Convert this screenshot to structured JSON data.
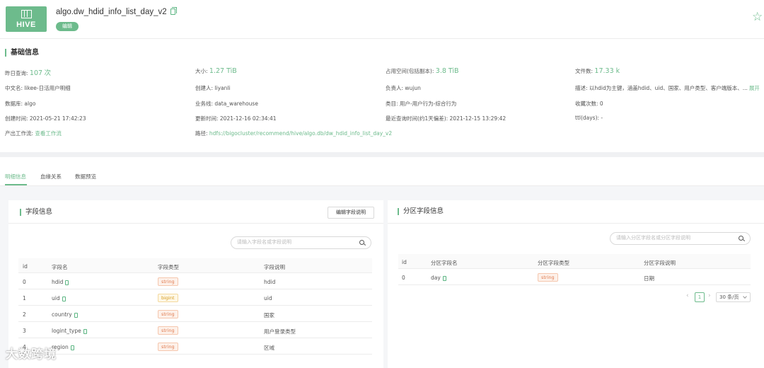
{
  "header": {
    "logo_text": "HIVE",
    "table_name": "algo.dw_hdid_info_list_day_v2",
    "edit_tag": "编辑"
  },
  "basic": {
    "title": "基础信息",
    "yesterday_query_label": "昨日查询:",
    "yesterday_query_value": "107",
    "yesterday_query_unit": "次",
    "size_label": "大小:",
    "size_value": "1.27 TiB",
    "space_label": "占用空间(包括副本):",
    "space_value": "3.8 TiB",
    "file_count_label": "文件数:",
    "file_count_value": "17.33 k",
    "cn_name": "中文名: likee-日活用户明细",
    "creator": "创建人: liyanli",
    "owner": "负责人: wujun",
    "desc": "描述: 以hdid为主键，涵盖hdid、uid、国家、用户类型、客户端版本、...",
    "desc_more": "展开",
    "database": "数据库: algo",
    "business_line": "业务线: data_warehouse",
    "category": "类目: 用户-用户行为-综合行为",
    "favorites": "收藏次数: 0",
    "create_time": "创建时间: 2021-05-21 17:42:23",
    "update_time": "更新时间: 2021-12-16 02:34:41",
    "last_query": "最近查询时间(约1天偏差): 2021-12-15 13:29:42",
    "ttl": "ttl(days): -",
    "workflow_label": "产出工作流:",
    "workflow_link": "查看工作流",
    "path_label": "路径:",
    "path_value": "hdfs://bigocluster/recommend/hive/algo.db/dw_hdid_info_list_day_v2"
  },
  "tabs": [
    "明细信息",
    "血缘关系",
    "数据预览"
  ],
  "fields_panel": {
    "title": "字段信息",
    "edit_button": "编辑字段说明",
    "search_placeholder": "请输入字段名或字段说明",
    "columns": [
      "id",
      "字段名",
      "字段类型",
      "字段说明"
    ],
    "rows": [
      {
        "id": "0",
        "name": "hdid",
        "type": "string",
        "desc": "hdid"
      },
      {
        "id": "1",
        "name": "uid",
        "type": "bigint",
        "desc": "uid"
      },
      {
        "id": "2",
        "name": "country",
        "type": "string",
        "desc": "国家"
      },
      {
        "id": "3",
        "name": "logint_type",
        "type": "string",
        "desc": "用户登录类型"
      },
      {
        "id": "4",
        "name": "region",
        "type": "string",
        "desc": "区域"
      }
    ]
  },
  "partition_panel": {
    "title": "分区字段信息",
    "search_placeholder": "请输入分区字段名或分区字段说明",
    "columns": [
      "id",
      "分区字段名",
      "分区字段类型",
      "分区字段说明"
    ],
    "rows": [
      {
        "id": "0",
        "name": "day",
        "type": "string",
        "desc": "日期"
      }
    ],
    "pager": {
      "current": "1",
      "page_size": "30 条/页"
    }
  },
  "watermark": "大数跨境",
  "colors": {
    "accent": "#6dbb8c",
    "string_tag": "#e07a4f",
    "bigint_tag": "#d49a1f"
  }
}
